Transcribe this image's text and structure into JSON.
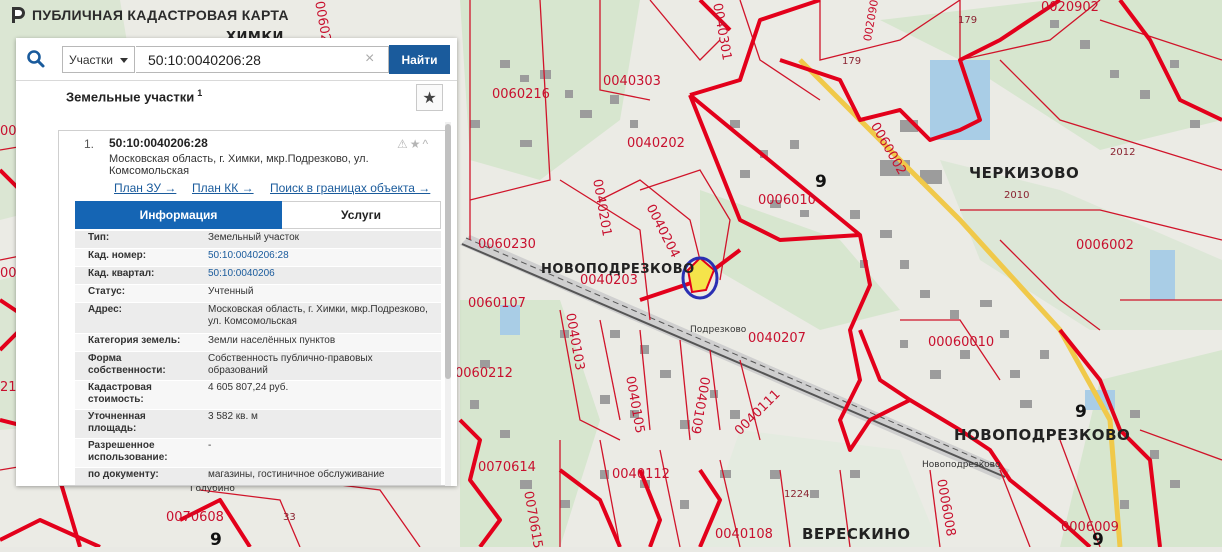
{
  "app": {
    "title": "ПУБЛИЧНАЯ КАДАСТРОВАЯ КАРТА",
    "logo_icon": "cadastral-logo-icon"
  },
  "search": {
    "type_label": "Участки",
    "query": "50:10:0040206:28",
    "clear_icon": "×",
    "find_label": "Найти"
  },
  "results": {
    "title": "Земельные участки",
    "count": "1",
    "favorite_icon": "★",
    "item": {
      "index": "1.",
      "number": "50:10:0040206:28",
      "address": "Московская область, г. Химки, мкр.Подрезково, ул. Комсомольская",
      "icons": "⚠★^",
      "links": {
        "plan_zu": "План ЗУ →",
        "plan_kk": "План КК →",
        "search_area": "Поиск в границах объекта →"
      },
      "tabs": {
        "info": "Информация",
        "services": "Услуги"
      },
      "fields": [
        {
          "label": "Тип:",
          "value": "Земельный участок"
        },
        {
          "label": "Кад. номер:",
          "value": "50:10:0040206:28"
        },
        {
          "label": "Кад. квартал:",
          "value": "50:10:0040206"
        },
        {
          "label": "Статус:",
          "value": "Учтенный"
        },
        {
          "label": "Адрес:",
          "value": "Московская область, г. Химки, мкр.Подрезково, ул. Комсомольская"
        },
        {
          "label": "Категория земель:",
          "value": "Земли населённых пунктов"
        },
        {
          "label": "Форма собственности:",
          "value": "Собственность публично-правовых образований"
        },
        {
          "label": "Кадастровая стоимость:",
          "value": "4 605 807,24 руб."
        },
        {
          "label": "Уточненная площадь:",
          "value": "3 582 кв. м"
        },
        {
          "label": "Разрешенное использование:",
          "value": "-"
        },
        {
          "label": "по документу:",
          "value": "магазины, гостиничное обслуживание"
        }
      ]
    }
  },
  "map": {
    "boundary_color": "#e3001b",
    "selection_color": "#2a2fb3",
    "labels": {
      "q0040202": "0040202",
      "q0040203": "0040203",
      "q0040204": "0040204",
      "q0040201": "0040201",
      "q0040207": "0040207",
      "q0040301": "0040301",
      "q0040303": "0040303",
      "q0060216": "0060216",
      "q0060230": "0060230",
      "q0060107": "0060107",
      "q0060101": "0060101",
      "q0060113": "0060113",
      "q0040103": "0040103",
      "q0040105": "0040105",
      "q0040109": "0040109",
      "q0040111": "0040111",
      "q0040112": "0040112",
      "q0040108": "0040108",
      "q0070614": "0070614",
      "q0070608": "0070608",
      "q0060002": "0060002",
      "q0006002": "0006002",
      "q0006010": "0006010",
      "q00060010": "00060010",
      "q0006009": "0006009",
      "q0006008": "0006008",
      "q0020902": "0020902",
      "q0020902b": "0020902",
      "q0060208": "0060208",
      "q0070615": "0070615",
      "q0060212": "0060212",
      "n179": "179",
      "n179b": "179",
      "n2012": "2012",
      "n2010": "2010",
      "n1224": "1224",
      "n33": "33",
      "n19": "19",
      "n21": "21",
      "road9a": "9",
      "road9b": "9",
      "road9c": "9",
      "road9d": "9",
      "khimki": "ХИМКИ",
      "novopodrezkovo_w": "НОВОПОДРЕЗКОВО",
      "novopodrezkovo_e": "НОВОПОДРЕЗКОВО",
      "cherkizovo": "ЧЕРКИЗОВО",
      "vereskino": "ВЕРЕСКИНО",
      "podrezkovo_station": "Подрезково",
      "novopodrezkovo_station": "Новоподрезково",
      "golubino": "Голубино"
    }
  }
}
